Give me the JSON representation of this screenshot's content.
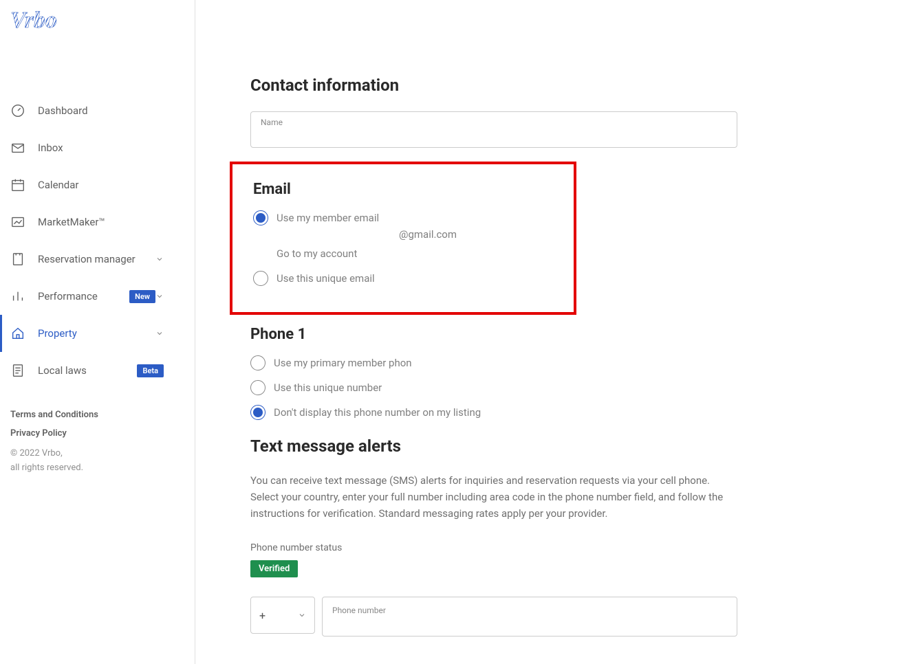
{
  "logo": "Vrbo",
  "sidebar": {
    "items": [
      {
        "label": "Dashboard"
      },
      {
        "label": "Inbox"
      },
      {
        "label": "Calendar"
      },
      {
        "label": "MarketMaker™"
      },
      {
        "label": "Reservation manager"
      },
      {
        "label": "Performance",
        "badge": "New"
      },
      {
        "label": "Property"
      },
      {
        "label": "Local laws",
        "badge": "Beta"
      }
    ],
    "footer": {
      "terms": "Terms and Conditions",
      "privacy": "Privacy Policy",
      "copyright1": "© 2022 Vrbo,",
      "copyright2": "all rights reserved."
    }
  },
  "main": {
    "contact_heading": "Contact information",
    "name_label": "Name",
    "email": {
      "heading": "Email",
      "option1": "Use my member email",
      "email_value": "@gmail.com",
      "account_link": "Go to my account",
      "option2": "Use this unique email"
    },
    "phone": {
      "heading": "Phone 1",
      "option1": "Use my primary member phon",
      "option2": "Use this unique number",
      "option3": "Don't display this phone number on my listing"
    },
    "text_alerts": {
      "heading": "Text message alerts",
      "description": "You can receive text message (SMS) alerts for inquiries and reservation requests via your cell phone. Select your country, enter your full number including area code in the phone number field, and follow the instructions for verification. Standard messaging rates apply per your provider.",
      "status_label": "Phone number status",
      "verified": "Verified",
      "country_prefix": "+",
      "phone_label": "Phone number"
    }
  }
}
